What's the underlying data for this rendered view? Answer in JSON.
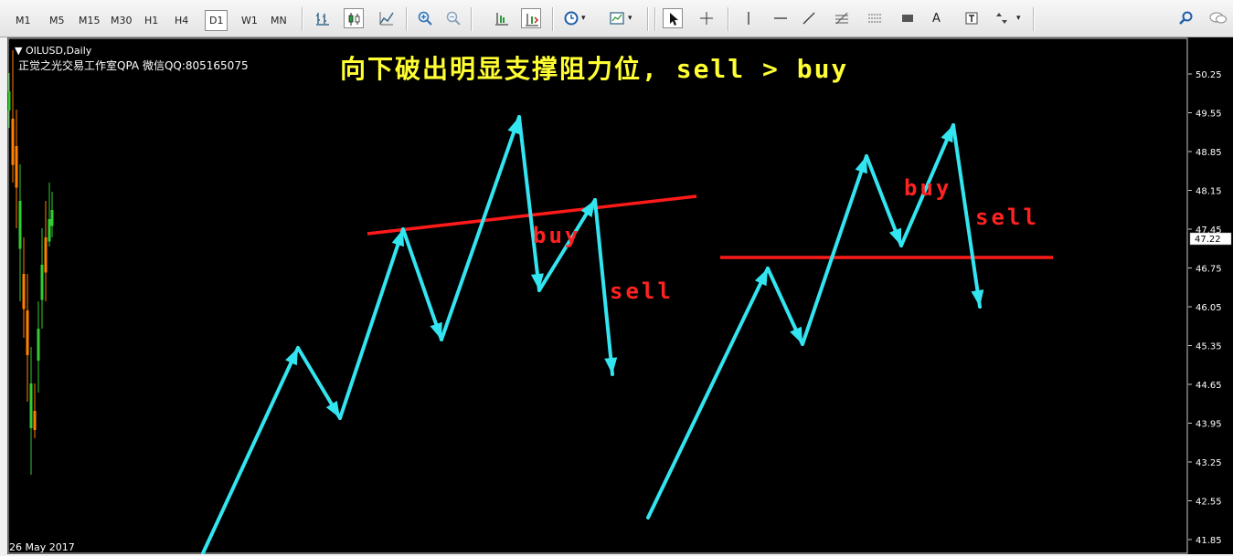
{
  "toolbar": {
    "timeframes": [
      "M1",
      "M5",
      "M15",
      "M30",
      "H1",
      "H4",
      "D1",
      "W1",
      "MN"
    ],
    "active_timeframe": "D1",
    "icons": [
      "bar-chart-icon",
      "candlestick-icon",
      "line-chart-icon",
      "zoom-in-icon",
      "zoom-out-icon",
      "chart-shift-icon",
      "autoscroll-icon",
      "periods-icon",
      "templates-icon",
      "cursor-icon",
      "crosshair-icon",
      "vertical-line-icon",
      "horizontal-line-icon",
      "trendline-icon",
      "fibonacci-icon",
      "channel-icon",
      "rectangle-icon",
      "text-icon",
      "text-label-icon",
      "arrows-icon",
      "search-icon",
      "chat-icon"
    ]
  },
  "chart": {
    "symbol": "▼ OILUSD,Daily",
    "studio": "正觉之光交易工作室QPA 微信QQ:805165075",
    "headline": "向下破出明显支撑阻力位, sell > buy",
    "labels": {
      "left_buy": "buy",
      "left_sell": "sell",
      "right_buy": "buy",
      "right_sell": "sell"
    },
    "date_label": "26 May 2017",
    "current_price": "47.22",
    "price_axis": [
      "50.25",
      "49.55",
      "48.85",
      "48.15",
      "47.45",
      "46.75",
      "46.05",
      "45.35",
      "44.65",
      "43.95",
      "43.25",
      "42.55",
      "41.85"
    ],
    "colors": {
      "background": "#000000",
      "arrow": "#33e5f0",
      "level": "#ff1a1a",
      "headline": "#ffff33",
      "label": "#ff2222",
      "bull": "#32cd32",
      "bear": "#ff7f00"
    }
  }
}
